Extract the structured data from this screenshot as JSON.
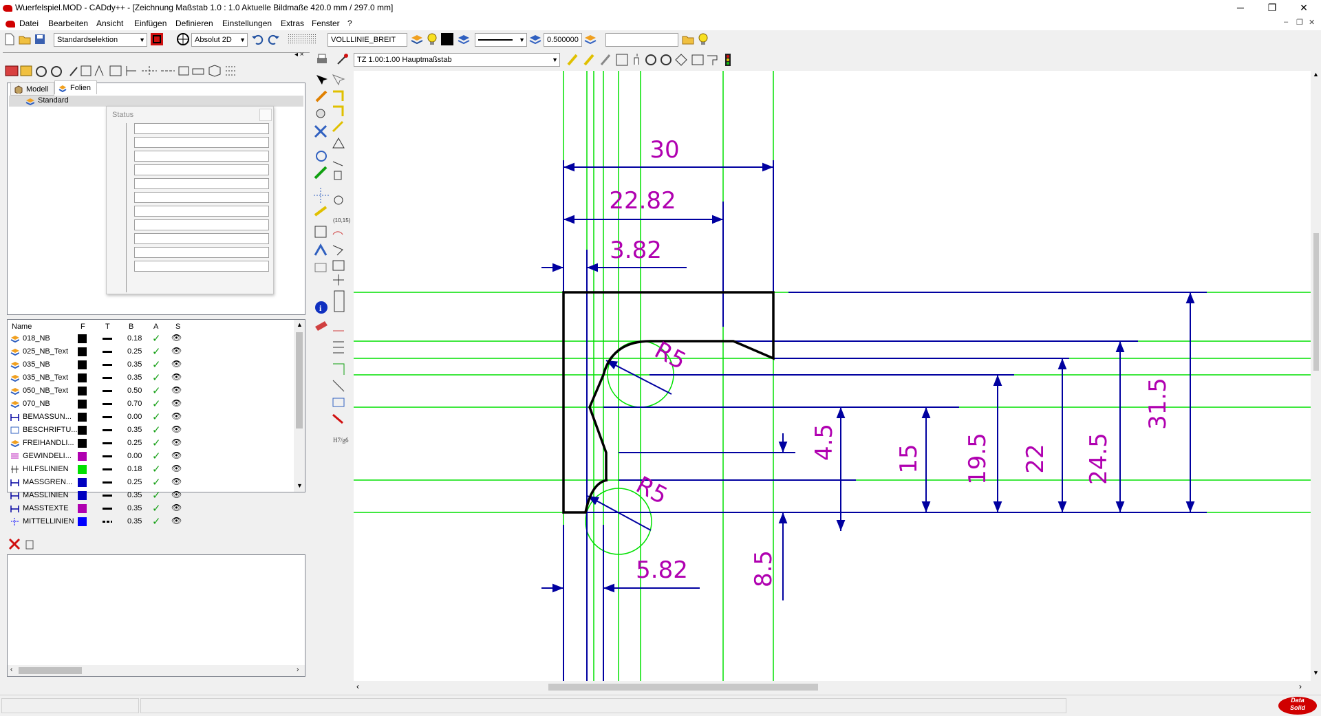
{
  "window": {
    "title": "Wuerfelspiel.MOD  -  CADdy++ - [Zeichnung   Maßstab 1.0 : 1.0    Aktuelle Bildmaße 420.0 mm / 297.0 mm]",
    "minimize": "─",
    "restore": "❐",
    "close": "✕"
  },
  "menu": [
    "Datei",
    "Bearbeiten",
    "Ansicht",
    "Einfügen",
    "Definieren",
    "Einstellungen",
    "Extras",
    "Fenster",
    "?"
  ],
  "toolbar": {
    "selection_mode": "Standardselektion",
    "coordinate_mode": "Absolut 2D",
    "linetype": "VOLLLINIE_BREIT",
    "line_width": "0.500000",
    "extra_field": "",
    "view_combo": "TZ 1.00:1.00 Hauptmaßstab"
  },
  "tabs": {
    "model": "Modell",
    "layers": "Folien"
  },
  "layer_tree": {
    "root": "Standard"
  },
  "status_popup": {
    "title": "Status",
    "rows": 11
  },
  "layer_table": {
    "headers": [
      "Name",
      "F",
      "T",
      "B",
      "A",
      "S"
    ],
    "rows": [
      {
        "name": "018_NB",
        "color": "#000000",
        "width": "0.18",
        "icon": "layer"
      },
      {
        "name": "025_NB_Text",
        "color": "#000000",
        "width": "0.25",
        "icon": "layer"
      },
      {
        "name": "035_NB",
        "color": "#000000",
        "width": "0.35",
        "icon": "layer"
      },
      {
        "name": "035_NB_Text",
        "color": "#000000",
        "width": "0.35",
        "icon": "layer"
      },
      {
        "name": "050_NB_Text",
        "color": "#000000",
        "width": "0.50",
        "icon": "layer"
      },
      {
        "name": "070_NB",
        "color": "#000000",
        "width": "0.70",
        "icon": "layer"
      },
      {
        "name": "BEMASSUN...",
        "color": "#000000",
        "width": "0.00",
        "icon": "dim"
      },
      {
        "name": "BESCHRIFTU...",
        "color": "#000000",
        "width": "0.35",
        "icon": "text"
      },
      {
        "name": "FREIHANDLI...",
        "color": "#000000",
        "width": "0.25",
        "icon": "layer"
      },
      {
        "name": "GEWINDELI...",
        "color": "#b000b0",
        "width": "0.00",
        "icon": "thread"
      },
      {
        "name": "HILFSLINIEN",
        "color": "#00e000",
        "width": "0.18",
        "icon": "aux"
      },
      {
        "name": "MASSGREN...",
        "color": "#0000c0",
        "width": "0.25",
        "icon": "dim"
      },
      {
        "name": "MASSLINIEN",
        "color": "#0000c0",
        "width": "0.35",
        "icon": "dim"
      },
      {
        "name": "MASSTEXTE",
        "color": "#b000b0",
        "width": "0.35",
        "icon": "dim"
      },
      {
        "name": "MITTELLINIEN",
        "color": "#0000ff",
        "width": "0.35",
        "icon": "center"
      }
    ]
  },
  "drawing": {
    "dimensions": [
      "30",
      "22.82",
      "3.82",
      "5.82",
      "4.5",
      "8.5",
      "15",
      "19.5",
      "22",
      "24.5",
      "31.5"
    ],
    "radii": [
      "R5",
      "R5"
    ],
    "colors": {
      "construction": "#00e000",
      "dimension": "#0000a0",
      "dim_text": "#b000b0",
      "contour": "#000000"
    }
  },
  "brand": {
    "line1": "Data",
    "line2": "Solid"
  }
}
